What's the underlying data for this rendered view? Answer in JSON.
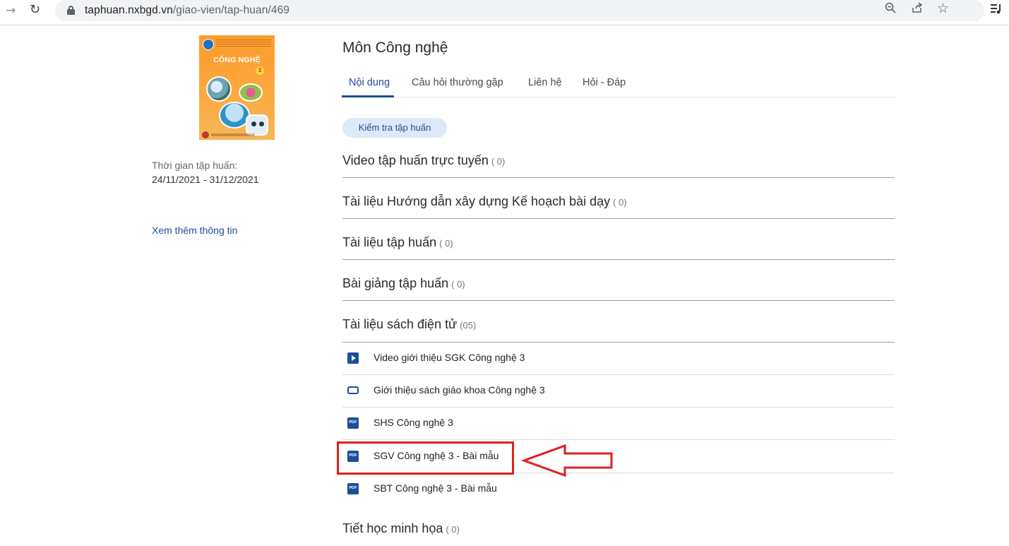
{
  "browser": {
    "url_host": "taphuan.nxbgd.vn",
    "url_path": "/giao-vien/tap-huan/469"
  },
  "sidebar": {
    "cover_title": "CÔNG NGHỆ",
    "cover_grade": "3",
    "time_label": "Thời gian tập huấn:",
    "time_value": "24/11/2021 - 31/12/2021",
    "more_info": "Xem thêm thông tin"
  },
  "main": {
    "title": "Môn Công nghệ",
    "tabs": [
      {
        "label": "Nội dung",
        "active": true
      },
      {
        "label": "Câu hỏi thường gặp",
        "active": false
      },
      {
        "label": "Liên hệ",
        "active": false
      },
      {
        "label": "Hỏi - Đáp",
        "active": false
      }
    ],
    "check_button": "Kiểm tra tập huấn",
    "sections": [
      {
        "title": "Video tập huấn trực tuyến",
        "count": "( 0)"
      },
      {
        "title": "Tài liệu Hướng dẫn xây dựng Kế hoạch bài dạy",
        "count": "( 0)"
      },
      {
        "title": "Tài liệu tập huấn",
        "count": "( 0)"
      },
      {
        "title": "Bài giảng tập huấn",
        "count": "( 0)"
      },
      {
        "title": "Tài liệu sách điện tử",
        "count": "(05)"
      },
      {
        "title": "Tiết học minh họa",
        "count": "( 0)"
      }
    ],
    "documents": [
      {
        "label": "Video giới thiệu SGK Công nghệ 3",
        "icon": "play-video-icon"
      },
      {
        "label": "Giới thiệu sách giáo khoa Công nghệ 3",
        "icon": "ebook-icon"
      },
      {
        "label": "SHS Công nghệ 3",
        "icon": "pdf-icon"
      },
      {
        "label": "SGV Công nghệ 3 - Bài mẫu",
        "icon": "pdf-icon"
      },
      {
        "label": "SBT Công nghệ 3 - Bài mẫu",
        "icon": "pdf-icon"
      }
    ],
    "pdf_badge": "PDF"
  },
  "colors": {
    "accent": "#1b4f9c",
    "highlight": "#e0201c",
    "button_bg": "#dde9f7"
  }
}
